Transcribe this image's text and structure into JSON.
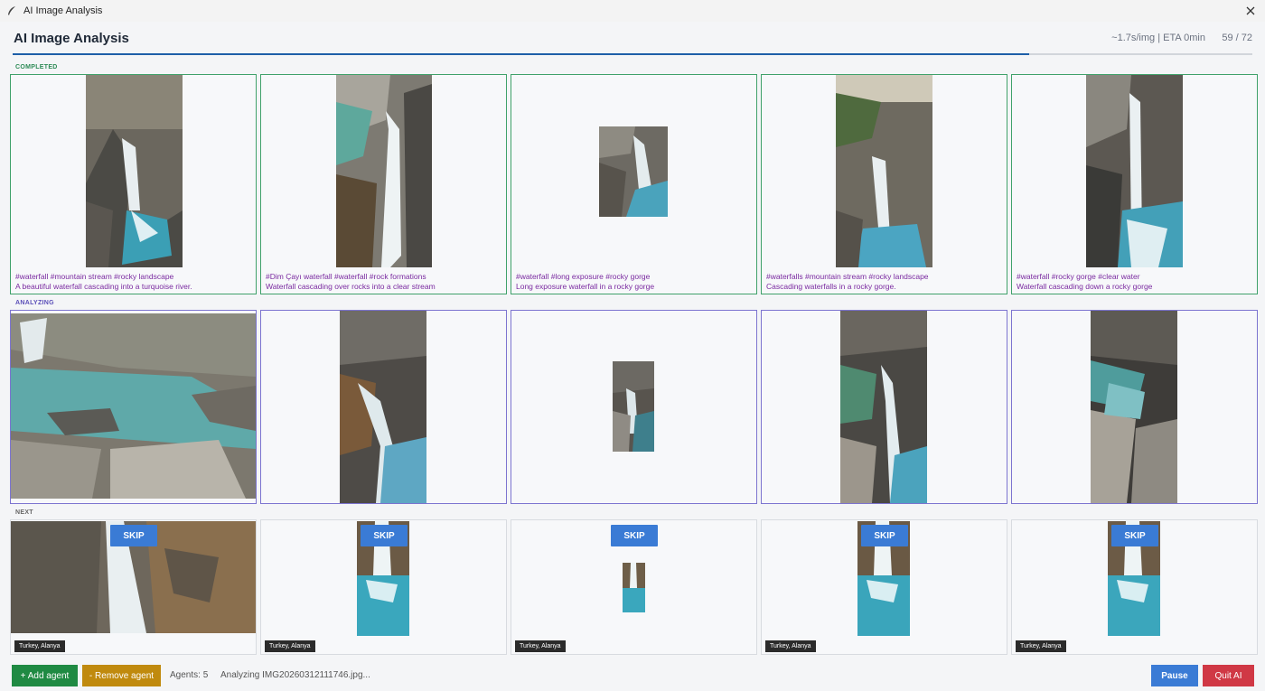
{
  "window": {
    "title": "AI Image Analysis"
  },
  "header": {
    "title": "AI Image Analysis",
    "stats": "~1.7s/img | ETA 0min",
    "count": "59 / 72",
    "progress": 0.82
  },
  "sections": {
    "completed": "COMPLETED",
    "analyzing": "ANALYZING",
    "next": "NEXT"
  },
  "completed": [
    {
      "tags": "#waterfall #mountain stream #rocky landscape",
      "description": "A beautiful waterfall cascading into a turquoise river."
    },
    {
      "tags": "#Dim Çayı waterfall #waterfall #rock formations",
      "description": "Waterfall cascading over rocks into a clear stream"
    },
    {
      "tags": "#waterfall #long exposure #rocky gorge",
      "description": "Long exposure waterfall in a rocky gorge"
    },
    {
      "tags": "#waterfalls #mountain stream #rocky landscape",
      "description": "Cascading waterfalls in a rocky gorge."
    },
    {
      "tags": "#waterfall #rocky gorge #clear water",
      "description": "Waterfall cascading down a rocky gorge"
    }
  ],
  "next": [
    {
      "skip_label": "SKIP",
      "location": "Turkey, Alanya"
    },
    {
      "skip_label": "SKIP",
      "location": "Turkey, Alanya"
    },
    {
      "skip_label": "SKIP",
      "location": "Turkey, Alanya"
    },
    {
      "skip_label": "SKIP",
      "location": "Turkey, Alanya"
    },
    {
      "skip_label": "SKIP",
      "location": "Turkey, Alanya"
    }
  ],
  "footer": {
    "add_agent": "+ Add agent",
    "remove_agent": "- Remove agent",
    "agents": "Agents: 5",
    "status": "Analyzing IMG20260312111746.jpg...",
    "pause": "Pause",
    "quit": "Quit AI"
  },
  "colors": {
    "completed_border": "#3fa16a",
    "analyzing_border": "#7c74d0",
    "caption": "#7a2aa0",
    "accent": "#1e5fa8"
  },
  "icons": {
    "app": "feather-icon",
    "close": "close-icon"
  }
}
